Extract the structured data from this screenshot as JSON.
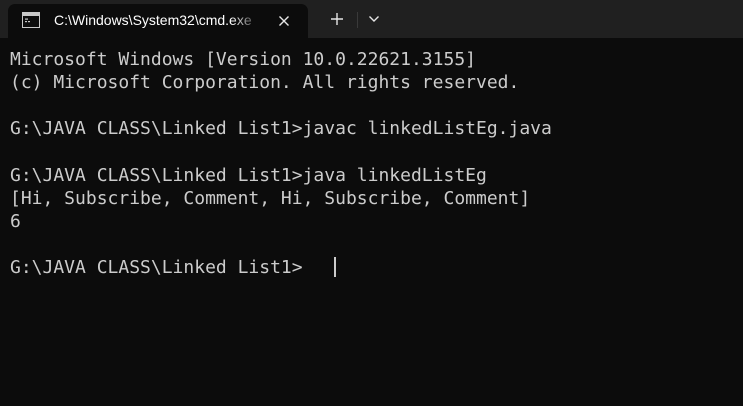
{
  "tab": {
    "icon": "cmd-console-icon",
    "title": "C:\\Windows\\System32\\cmd.exe",
    "close_icon": "close-icon"
  },
  "tabstrip": {
    "new_tab_icon": "plus-icon",
    "dropdown_icon": "chevron-down-icon"
  },
  "colors": {
    "titlebar": "#202020",
    "terminal_background": "#0c0c0c",
    "text": "#cccccc"
  },
  "terminal": {
    "lines": [
      "Microsoft Windows [Version 10.0.22621.3155]",
      "(c) Microsoft Corporation. All rights reserved.",
      "",
      "G:\\JAVA CLASS\\Linked List1>javac linkedListEg.java",
      "",
      "G:\\JAVA CLASS\\Linked List1>java linkedListEg",
      "[Hi, Subscribe, Comment, Hi, Subscribe, Comment]",
      "6",
      "",
      "G:\\JAVA CLASS\\Linked List1>"
    ]
  }
}
